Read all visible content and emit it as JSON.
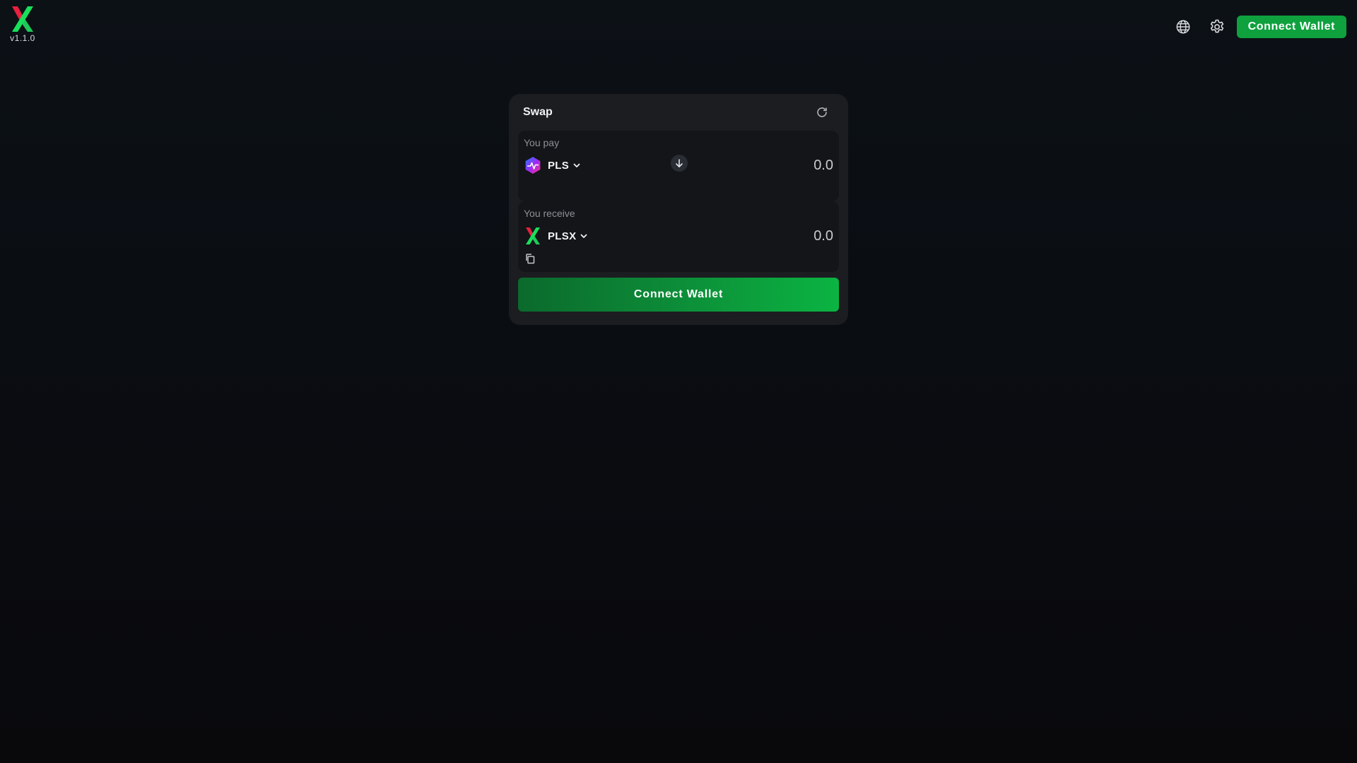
{
  "app": {
    "version": "v1.1.0"
  },
  "header": {
    "language_icon": "globe-icon",
    "settings_icon": "gear-icon",
    "connect_label": "Connect Wallet"
  },
  "swap": {
    "title": "Swap",
    "refresh_icon": "refresh-icon",
    "pay": {
      "label": "You pay",
      "token": "PLS",
      "amount_placeholder": "0.0"
    },
    "receive": {
      "label": "You receive",
      "token": "PLSX",
      "amount_placeholder": "0.0",
      "copy_icon": "copy-icon"
    },
    "switch_icon": "arrow-down-icon",
    "connect_label": "Connect Wallet"
  },
  "colors": {
    "accent": "#0ea13e",
    "card": "#1b1d21",
    "panel": "#131518",
    "muted_text": "#8d9097"
  }
}
